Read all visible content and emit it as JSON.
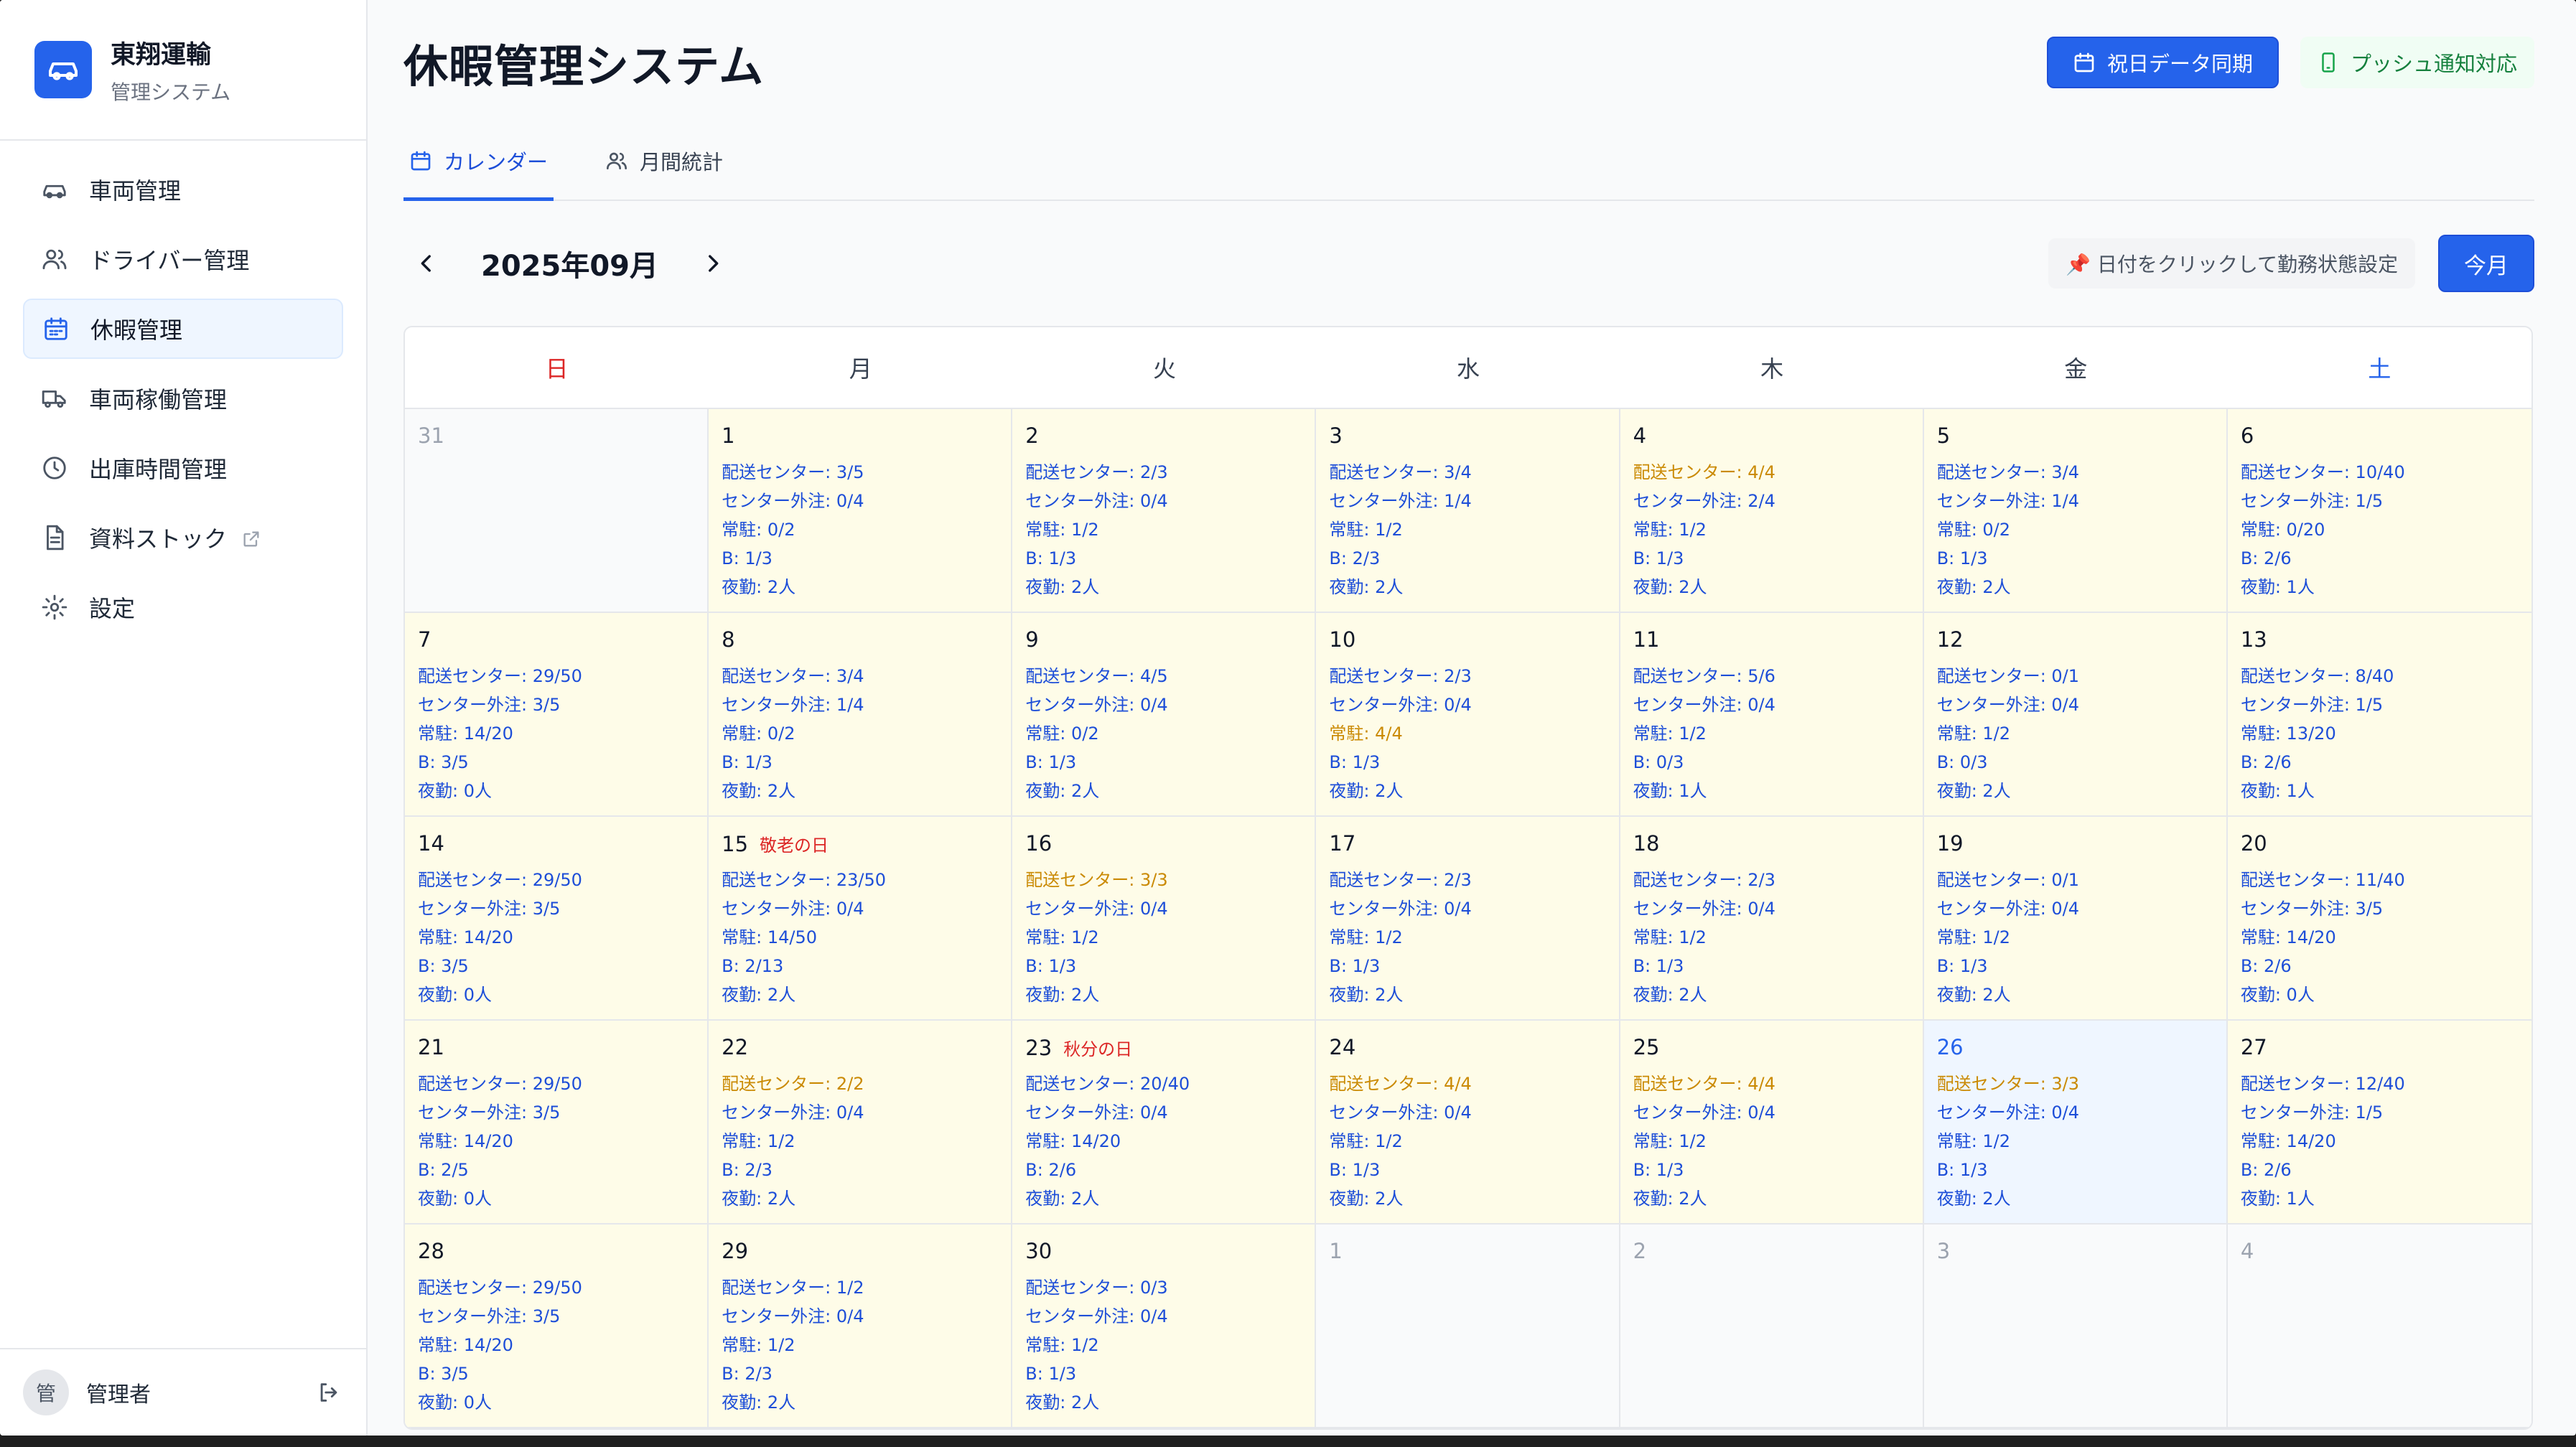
{
  "brand": {
    "name": "東翔運輸",
    "subtitle": "管理システム"
  },
  "sidebar": {
    "items": [
      {
        "label": "車両管理",
        "icon": "car-icon"
      },
      {
        "label": "ドライバー管理",
        "icon": "users-icon"
      },
      {
        "label": "休暇管理",
        "icon": "calendar-icon",
        "active": true
      },
      {
        "label": "車両稼働管理",
        "icon": "truck-icon"
      },
      {
        "label": "出庫時間管理",
        "icon": "clock-icon"
      },
      {
        "label": "資料ストック",
        "icon": "document-icon",
        "external": true
      },
      {
        "label": "設定",
        "icon": "gear-icon"
      }
    ],
    "user": {
      "avatar": "管",
      "name": "管理者"
    }
  },
  "header": {
    "title": "休暇管理システム",
    "sync_button": "祝日データ同期",
    "push_button": "プッシュ通知対応"
  },
  "tabs": [
    {
      "label": "カレンダー",
      "active": true
    },
    {
      "label": "月間統計",
      "active": false
    }
  ],
  "calendar": {
    "month_label": "2025年09月",
    "hint": "📌 日付をクリックして勤務状態設定",
    "today_button": "今月",
    "weekdays": [
      "日",
      "月",
      "火",
      "水",
      "木",
      "金",
      "土"
    ],
    "days": [
      {
        "num": "31",
        "other": true
      },
      {
        "num": "1",
        "stats": [
          [
            "配送センター: 3/5",
            false
          ],
          [
            "センター外注: 0/4",
            false
          ],
          [
            "常駐: 0/2",
            false
          ],
          [
            "B: 1/3",
            false
          ],
          [
            "夜勤: 2人",
            false
          ]
        ]
      },
      {
        "num": "2",
        "stats": [
          [
            "配送センター: 2/3",
            false
          ],
          [
            "センター外注: 0/4",
            false
          ],
          [
            "常駐: 1/2",
            false
          ],
          [
            "B: 1/3",
            false
          ],
          [
            "夜勤: 2人",
            false
          ]
        ]
      },
      {
        "num": "3",
        "stats": [
          [
            "配送センター: 3/4",
            false
          ],
          [
            "センター外注: 1/4",
            false
          ],
          [
            "常駐: 1/2",
            false
          ],
          [
            "B: 2/3",
            false
          ],
          [
            "夜勤: 2人",
            false
          ]
        ]
      },
      {
        "num": "4",
        "stats": [
          [
            "配送センター: 4/4",
            true
          ],
          [
            "センター外注: 2/4",
            false
          ],
          [
            "常駐: 1/2",
            false
          ],
          [
            "B: 1/3",
            false
          ],
          [
            "夜勤: 2人",
            false
          ]
        ]
      },
      {
        "num": "5",
        "stats": [
          [
            "配送センター: 3/4",
            false
          ],
          [
            "センター外注: 1/4",
            false
          ],
          [
            "常駐: 0/2",
            false
          ],
          [
            "B: 1/3",
            false
          ],
          [
            "夜勤: 2人",
            false
          ]
        ]
      },
      {
        "num": "6",
        "stats": [
          [
            "配送センター: 10/40",
            false
          ],
          [
            "センター外注: 1/5",
            false
          ],
          [
            "常駐: 0/20",
            false
          ],
          [
            "B: 2/6",
            false
          ],
          [
            "夜勤: 1人",
            false
          ]
        ]
      },
      {
        "num": "7",
        "stats": [
          [
            "配送センター: 29/50",
            false
          ],
          [
            "センター外注: 3/5",
            false
          ],
          [
            "常駐: 14/20",
            false
          ],
          [
            "B: 3/5",
            false
          ],
          [
            "夜勤: 0人",
            false
          ]
        ]
      },
      {
        "num": "8",
        "stats": [
          [
            "配送センター: 3/4",
            false
          ],
          [
            "センター外注: 1/4",
            false
          ],
          [
            "常駐: 0/2",
            false
          ],
          [
            "B: 1/3",
            false
          ],
          [
            "夜勤: 2人",
            false
          ]
        ]
      },
      {
        "num": "9",
        "stats": [
          [
            "配送センター: 4/5",
            false
          ],
          [
            "センター外注: 0/4",
            false
          ],
          [
            "常駐: 0/2",
            false
          ],
          [
            "B: 1/3",
            false
          ],
          [
            "夜勤: 2人",
            false
          ]
        ]
      },
      {
        "num": "10",
        "stats": [
          [
            "配送センター: 2/3",
            false
          ],
          [
            "センター外注: 0/4",
            false
          ],
          [
            "常駐: 4/4",
            true
          ],
          [
            "B: 1/3",
            false
          ],
          [
            "夜勤: 2人",
            false
          ]
        ]
      },
      {
        "num": "11",
        "stats": [
          [
            "配送センター: 5/6",
            false
          ],
          [
            "センター外注: 0/4",
            false
          ],
          [
            "常駐: 1/2",
            false
          ],
          [
            "B: 0/3",
            false
          ],
          [
            "夜勤: 1人",
            false
          ]
        ]
      },
      {
        "num": "12",
        "stats": [
          [
            "配送センター: 0/1",
            false
          ],
          [
            "センター外注: 0/4",
            false
          ],
          [
            "常駐: 1/2",
            false
          ],
          [
            "B: 0/3",
            false
          ],
          [
            "夜勤: 2人",
            false
          ]
        ]
      },
      {
        "num": "13",
        "stats": [
          [
            "配送センター: 8/40",
            false
          ],
          [
            "センター外注: 1/5",
            false
          ],
          [
            "常駐: 13/20",
            false
          ],
          [
            "B: 2/6",
            false
          ],
          [
            "夜勤: 1人",
            false
          ]
        ]
      },
      {
        "num": "14",
        "stats": [
          [
            "配送センター: 29/50",
            false
          ],
          [
            "センター外注: 3/5",
            false
          ],
          [
            "常駐: 14/20",
            false
          ],
          [
            "B: 3/5",
            false
          ],
          [
            "夜勤: 0人",
            false
          ]
        ]
      },
      {
        "num": "15",
        "holiday": "敬老の日",
        "stats": [
          [
            "配送センター: 23/50",
            false
          ],
          [
            "センター外注: 0/4",
            false
          ],
          [
            "常駐: 14/50",
            false
          ],
          [
            "B: 2/13",
            false
          ],
          [
            "夜勤: 2人",
            false
          ]
        ]
      },
      {
        "num": "16",
        "stats": [
          [
            "配送センター: 3/3",
            true
          ],
          [
            "センター外注: 0/4",
            false
          ],
          [
            "常駐: 1/2",
            false
          ],
          [
            "B: 1/3",
            false
          ],
          [
            "夜勤: 2人",
            false
          ]
        ]
      },
      {
        "num": "17",
        "stats": [
          [
            "配送センター: 2/3",
            false
          ],
          [
            "センター外注: 0/4",
            false
          ],
          [
            "常駐: 1/2",
            false
          ],
          [
            "B: 1/3",
            false
          ],
          [
            "夜勤: 2人",
            false
          ]
        ]
      },
      {
        "num": "18",
        "stats": [
          [
            "配送センター: 2/3",
            false
          ],
          [
            "センター外注: 0/4",
            false
          ],
          [
            "常駐: 1/2",
            false
          ],
          [
            "B: 1/3",
            false
          ],
          [
            "夜勤: 2人",
            false
          ]
        ]
      },
      {
        "num": "19",
        "stats": [
          [
            "配送センター: 0/1",
            false
          ],
          [
            "センター外注: 0/4",
            false
          ],
          [
            "常駐: 1/2",
            false
          ],
          [
            "B: 1/3",
            false
          ],
          [
            "夜勤: 2人",
            false
          ]
        ]
      },
      {
        "num": "20",
        "stats": [
          [
            "配送センター: 11/40",
            false
          ],
          [
            "センター外注: 3/5",
            false
          ],
          [
            "常駐: 14/20",
            false
          ],
          [
            "B: 2/6",
            false
          ],
          [
            "夜勤: 0人",
            false
          ]
        ]
      },
      {
        "num": "21",
        "stats": [
          [
            "配送センター: 29/50",
            false
          ],
          [
            "センター外注: 3/5",
            false
          ],
          [
            "常駐: 14/20",
            false
          ],
          [
            "B: 2/5",
            false
          ],
          [
            "夜勤: 0人",
            false
          ]
        ]
      },
      {
        "num": "22",
        "stats": [
          [
            "配送センター: 2/2",
            true
          ],
          [
            "センター外注: 0/4",
            false
          ],
          [
            "常駐: 1/2",
            false
          ],
          [
            "B: 2/3",
            false
          ],
          [
            "夜勤: 2人",
            false
          ]
        ]
      },
      {
        "num": "23",
        "holiday": "秋分の日",
        "stats": [
          [
            "配送センター: 20/40",
            false
          ],
          [
            "センター外注: 0/4",
            false
          ],
          [
            "常駐: 14/20",
            false
          ],
          [
            "B: 2/6",
            false
          ],
          [
            "夜勤: 2人",
            false
          ]
        ]
      },
      {
        "num": "24",
        "stats": [
          [
            "配送センター: 4/4",
            true
          ],
          [
            "センター外注: 0/4",
            false
          ],
          [
            "常駐: 1/2",
            false
          ],
          [
            "B: 1/3",
            false
          ],
          [
            "夜勤: 2人",
            false
          ]
        ]
      },
      {
        "num": "25",
        "stats": [
          [
            "配送センター: 4/4",
            true
          ],
          [
            "センター外注: 0/4",
            false
          ],
          [
            "常駐: 1/2",
            false
          ],
          [
            "B: 1/3",
            false
          ],
          [
            "夜勤: 2人",
            false
          ]
        ]
      },
      {
        "num": "26",
        "today": true,
        "stats": [
          [
            "配送センター: 3/3",
            true
          ],
          [
            "センター外注: 0/4",
            false
          ],
          [
            "常駐: 1/2",
            false
          ],
          [
            "B: 1/3",
            false
          ],
          [
            "夜勤: 2人",
            false
          ]
        ]
      },
      {
        "num": "27",
        "stats": [
          [
            "配送センター: 12/40",
            false
          ],
          [
            "センター外注: 1/5",
            false
          ],
          [
            "常駐: 14/20",
            false
          ],
          [
            "B: 2/6",
            false
          ],
          [
            "夜勤: 1人",
            false
          ]
        ]
      },
      {
        "num": "28",
        "stats": [
          [
            "配送センター: 29/50",
            false
          ],
          [
            "センター外注: 3/5",
            false
          ],
          [
            "常駐: 14/20",
            false
          ],
          [
            "B: 3/5",
            false
          ],
          [
            "夜勤: 0人",
            false
          ]
        ]
      },
      {
        "num": "29",
        "stats": [
          [
            "配送センター: 1/2",
            false
          ],
          [
            "センター外注: 0/4",
            false
          ],
          [
            "常駐: 1/2",
            false
          ],
          [
            "B: 2/3",
            false
          ],
          [
            "夜勤: 2人",
            false
          ]
        ]
      },
      {
        "num": "30",
        "stats": [
          [
            "配送センター: 0/3",
            false
          ],
          [
            "センター外注: 0/4",
            false
          ],
          [
            "常駐: 1/2",
            false
          ],
          [
            "B: 1/3",
            false
          ],
          [
            "夜勤: 2人",
            false
          ]
        ]
      },
      {
        "num": "1",
        "other": true
      },
      {
        "num": "2",
        "other": true
      },
      {
        "num": "3",
        "other": true
      },
      {
        "num": "4",
        "other": true
      }
    ]
  },
  "colors": {
    "primary": "#2563eb",
    "stat_text": "#1d4ed8",
    "stat_full": "#ca8a04",
    "holiday": "#dc2626",
    "cell_bg": "#fefce8",
    "today_bg": "#eff6ff"
  }
}
